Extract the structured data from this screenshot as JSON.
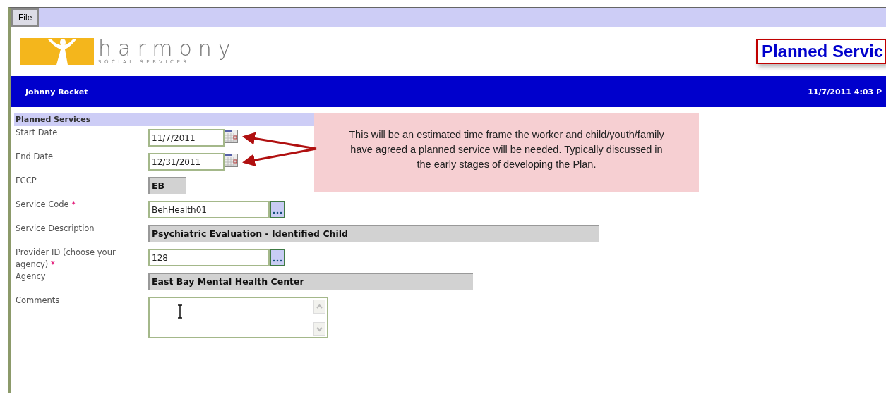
{
  "menu": {
    "items": [
      "File"
    ]
  },
  "logo": {
    "name": "harmony",
    "tagline": "SOCIAL SERVICES"
  },
  "page_title": "Planned Servic",
  "header_bar": {
    "user": "Johnny Rocket",
    "datetime": "11/7/2011 4:03 P"
  },
  "section": {
    "title": "Planned Services"
  },
  "fields": [
    {
      "kind": "date",
      "label": "Start Date",
      "value": "11/7/2011"
    },
    {
      "kind": "date",
      "label": "End Date",
      "value": "12/31/2011"
    },
    {
      "kind": "readonly",
      "label": "FCCP",
      "value": "EB"
    },
    {
      "kind": "lookup",
      "label": "Service Code",
      "marker": "*",
      "value": "BehHealth01"
    },
    {
      "kind": "readonly",
      "label": "Service Description",
      "value": "Psychiatric Evaluation - Identified Child"
    },
    {
      "kind": "lookup",
      "label": "Provider ID (choose your agency)",
      "marker": "*",
      "value": "128"
    },
    {
      "kind": "readonly",
      "label": "Agency",
      "value": "East Bay Mental Health Center"
    },
    {
      "kind": "textarea",
      "label": "Comments"
    }
  ],
  "callout": {
    "text": "This will be an estimated time frame the worker and child/youth/family have agreed a planned service will be needed. Typically discussed in the early stages of developing the Plan."
  }
}
